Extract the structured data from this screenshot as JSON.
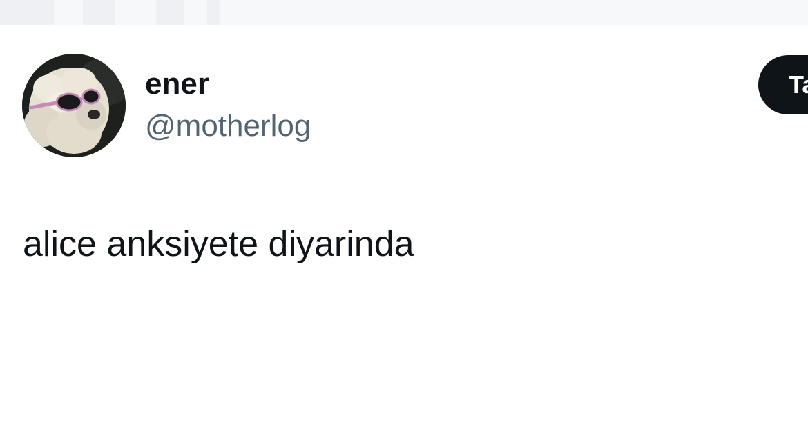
{
  "tweet": {
    "author": {
      "display_name": "ener",
      "handle": "@motherlog",
      "avatar_icon": "dog-with-sunglasses-avatar"
    },
    "follow_button_label": "Ta",
    "text": "alice anksiyete diyarinda"
  },
  "colors": {
    "text_primary": "#0f1419",
    "text_secondary": "#536471",
    "button_bg": "#0f1419",
    "button_text": "#ffffff",
    "background": "#ffffff"
  }
}
